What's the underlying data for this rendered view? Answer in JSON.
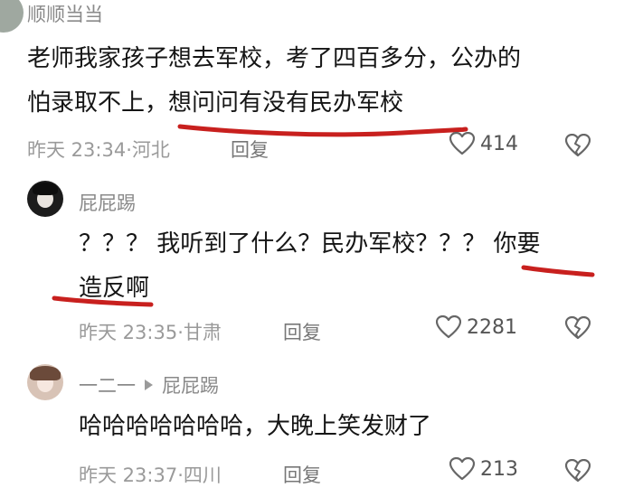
{
  "comments": [
    {
      "username": "顺顺当当",
      "line1": "老师我家孩子想去军校，考了四百多分，公办的",
      "line2": "怕录取不上，想问问有没有民办军校",
      "time": "昨天 23:34",
      "location": "河北",
      "reply_label": "回复",
      "like_count": "414"
    },
    {
      "username": "屁屁踢",
      "line1": "？？？ 我听到了什么？民办军校？？？ 你要",
      "line2": "造反啊",
      "time": "昨天 23:35",
      "location": "甘肃",
      "reply_label": "回复",
      "like_count": "2281"
    },
    {
      "username": "一二一",
      "reply_to": "屁屁踢",
      "line1": "哈哈哈哈哈哈哈，大晚上笑发财了",
      "time": "昨天 23:37",
      "location": "四川",
      "reply_label": "回复",
      "like_count": "213"
    }
  ],
  "meta_separator": "·",
  "colors": {
    "highlight_underline": "#c8201e",
    "meta_gray": "#9a9a9a"
  }
}
